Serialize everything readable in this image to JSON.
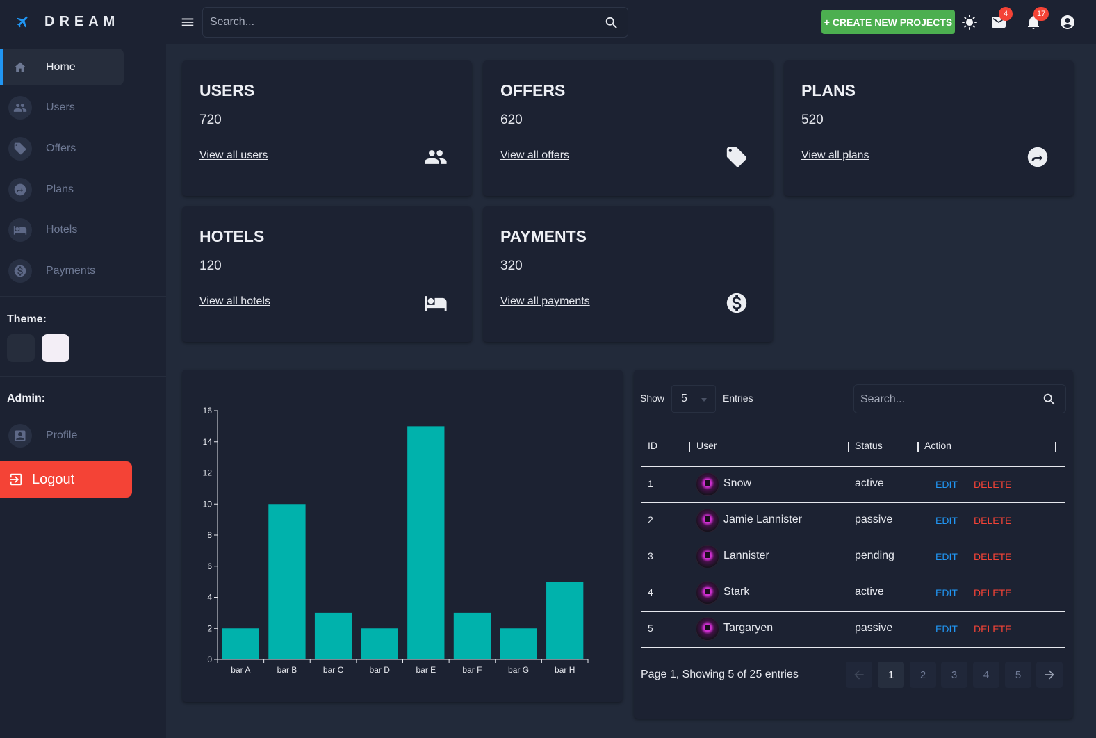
{
  "app": {
    "logo_text": "DREAM"
  },
  "sidebar": {
    "items": [
      {
        "label": "Home",
        "icon": "home-icon"
      },
      {
        "label": "Users",
        "icon": "users-icon"
      },
      {
        "label": "Offers",
        "icon": "tag-icon"
      },
      {
        "label": "Plans",
        "icon": "plans-icon"
      },
      {
        "label": "Hotels",
        "icon": "hotel-bed-icon"
      },
      {
        "label": "Payments",
        "icon": "dollar-icon"
      }
    ],
    "theme_title": "Theme:",
    "admin_title": "Admin:",
    "profile_label": "Profile",
    "logout_label": "Logout",
    "theme_colors": {
      "dark": "#262d3c",
      "light": "#f3eef6"
    }
  },
  "topbar": {
    "search_placeholder": "Search...",
    "create_label": "+ CREATE NEW PROJECTS",
    "mail_badge": "4",
    "notification_badge": "17"
  },
  "cards": [
    {
      "title": "USERS",
      "count": "720",
      "link": "View all users",
      "icon": "users-icon"
    },
    {
      "title": "OFFERS",
      "count": "620",
      "link": "View all offers",
      "icon": "tag-icon"
    },
    {
      "title": "PLANS",
      "count": "520",
      "link": "View all plans",
      "icon": "plans-icon"
    },
    {
      "title": "HOTELS",
      "count": "120",
      "link": "View all hotels",
      "icon": "hotel-bed-icon"
    },
    {
      "title": "PAYMENTS",
      "count": "320",
      "link": "View all payments",
      "icon": "dollar-icon"
    }
  ],
  "chart_data": {
    "type": "bar",
    "categories": [
      "bar A",
      "bar B",
      "bar C",
      "bar D",
      "bar E",
      "bar F",
      "bar G",
      "bar H"
    ],
    "values": [
      2,
      10,
      3,
      2,
      15,
      3,
      2,
      5
    ],
    "ylim": [
      0,
      16
    ],
    "yticks": [
      0,
      2,
      4,
      6,
      8,
      10,
      12,
      14,
      16
    ],
    "bar_color": "#00b2ac",
    "title": "",
    "xlabel": "",
    "ylabel": ""
  },
  "table": {
    "show_label": "Show",
    "entries_value": "5",
    "entries_label": "Entries",
    "search_placeholder": "Search...",
    "headers": [
      "ID",
      "User",
      "Status",
      "Action"
    ],
    "rows": [
      {
        "id": "1",
        "user": "Snow",
        "status": "active",
        "edit": "EDIT",
        "delete": "DELETE"
      },
      {
        "id": "2",
        "user": "Jamie Lannister",
        "status": "passive",
        "edit": "EDIT",
        "delete": "DELETE"
      },
      {
        "id": "3",
        "user": "Lannister",
        "status": "pending",
        "edit": "EDIT",
        "delete": "DELETE"
      },
      {
        "id": "4",
        "user": "Stark",
        "status": "active",
        "edit": "EDIT",
        "delete": "DELETE"
      },
      {
        "id": "5",
        "user": "Targaryen",
        "status": "passive",
        "edit": "EDIT",
        "delete": "DELETE"
      }
    ],
    "page_info": "Page 1, Showing 5 of 25 entries",
    "pages": [
      "1",
      "2",
      "3",
      "4",
      "5"
    ],
    "current_page": "1"
  },
  "colors": {
    "accent": "#2196f3",
    "create": "#4caf50",
    "logout": "#f44336",
    "edit": "#2196f3",
    "delete": "#f44336"
  }
}
